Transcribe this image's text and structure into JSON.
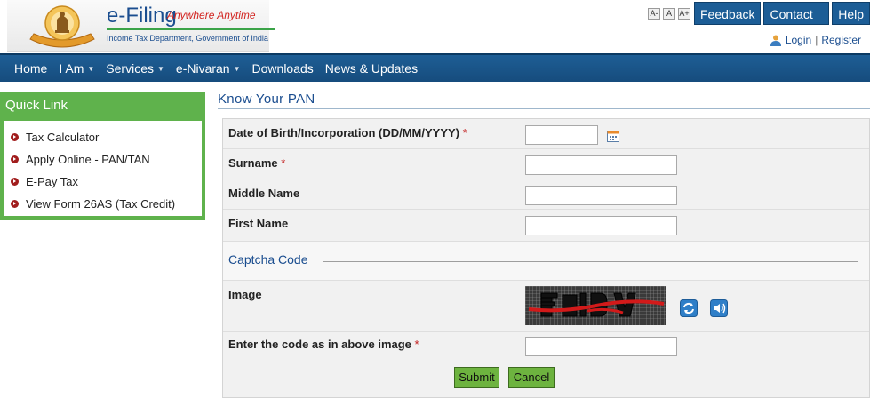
{
  "header": {
    "brand_title": "e-Filing",
    "brand_tagline": "Anywhere Anytime",
    "brand_subtitle": "Income Tax Department, Government of India",
    "font_sizes": [
      "A-",
      "A",
      "A+"
    ],
    "feedback_label": "Feedback",
    "contact_label": "Contact Us",
    "help_label": "Help",
    "login_label": "Login",
    "separator": "|",
    "register_label": "Register"
  },
  "nav": {
    "items": [
      {
        "label": "Home",
        "dropdown": false
      },
      {
        "label": "I Am",
        "dropdown": true
      },
      {
        "label": "Services",
        "dropdown": true
      },
      {
        "label": "e-Nivaran",
        "dropdown": true
      },
      {
        "label": "Downloads",
        "dropdown": false
      },
      {
        "label": "News & Updates",
        "dropdown": false
      }
    ]
  },
  "quick_link": {
    "title": "Quick Link",
    "items": [
      "Tax Calculator",
      "Apply Online - PAN/TAN",
      "E-Pay Tax",
      "View Form 26AS (Tax Credit)"
    ]
  },
  "main": {
    "title": "Know Your PAN",
    "form": {
      "dob_label": "Date of Birth/Incorporation (DD/MM/YYYY)",
      "dob_value": "",
      "surname_label": "Surname",
      "surname_value": "",
      "middle_label": "Middle Name",
      "middle_value": "",
      "first_label": "First Name",
      "first_value": "",
      "required_mark": "*",
      "captcha_section": "Captcha Code",
      "image_label": "Image",
      "code_label": "Enter the code as in above image",
      "code_value": "",
      "submit_label": "Submit",
      "cancel_label": "Cancel"
    }
  },
  "colors": {
    "nav_bg": "#1a5487",
    "quick_link_green": "#5fb24c",
    "button_green": "#6db33f",
    "link_blue": "#1a4d8f",
    "required_red": "#c21b1b"
  },
  "icons": {
    "emblem": "income-tax-emblem",
    "user": "user-icon",
    "calendar": "calendar-icon",
    "refresh": "refresh-icon",
    "audio": "speaker-icon",
    "bullet": "arrow-bullet-icon"
  }
}
